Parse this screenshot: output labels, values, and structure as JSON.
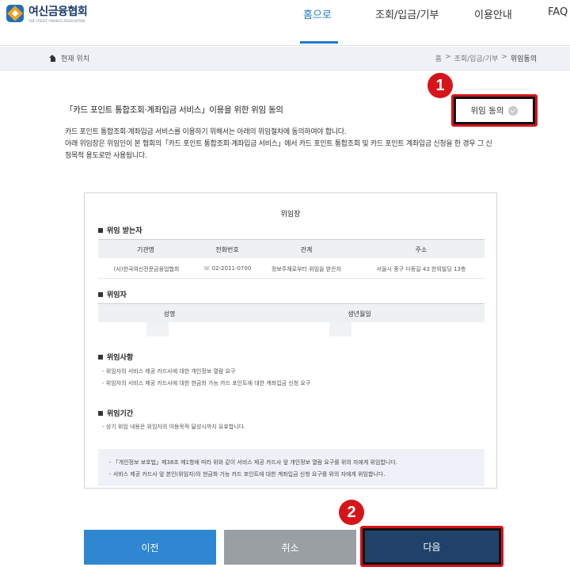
{
  "header": {
    "logo_title": "여신금융협회",
    "logo_sub": "THE CREDIT FINANCE ASSOCIATION",
    "nav": [
      "홈으로",
      "조회/입금/기부",
      "이용안내",
      "FAQ"
    ]
  },
  "breadcrumb": {
    "current_location": "현재 위치",
    "path": [
      "홈",
      ">",
      "조회/입금/기부",
      ">",
      "위임동의"
    ]
  },
  "consent": {
    "title": "「카드 포인트 통합조회·계좌입금 서비스」이용을 위한 위임 동의",
    "agree_label": "위임 동의",
    "desc_line1": "카드 포인트 통합조회·계좌입금 서비스를 이용하기 위해서는 아래의 위임절차에 동의하여야 합니다.",
    "desc_line2": "아래 위임장은 위임인이 본 협회의「카드 포인트 통합조회·계좌입금 서비스」에서 카드 포인트 통합조회 및 카드 포인트 계좌입금 신청을 한 경우 그 신",
    "desc_line3": "청목적 용도로만 사용됩니다."
  },
  "badges": {
    "one": "1",
    "two": "2"
  },
  "document": {
    "title": "위임장",
    "receiver_heading": "위임 받는자",
    "receiver_cols": [
      "기관명",
      "전화번호",
      "관계",
      "주소"
    ],
    "receiver_row": [
      "(사)한국여신전문금융업협회",
      "☏ 02-2011-0700",
      "정보주체로부터 위임을 받은자",
      "서울시 중구 다동길 43 한외빌딩 13층"
    ],
    "delegator_heading": "위임자",
    "delegator_cols": [
      "성명",
      "생년월일"
    ],
    "matters_heading": "위임사항",
    "matters": [
      "- 위임자의 서비스 제공 카드사에 대한 개인정보 열람 요구",
      "- 위임자의 서비스 제공 카드사에 대한 현금화 가능 카드 포인트에 대한 계좌입금 신청 요구"
    ],
    "period_heading": "위임기간",
    "period": [
      "- 상기 위임 내용은 위임자의 이용목적 달성시까지 유효합니다."
    ],
    "notes": [
      "- 「개인정보 보호법」제38조 제1항에 따라 위와 같이 서비스 제공 카드사 앞 개인정보 열람 요구를 위의 자에게 위임합니다.",
      "- 서비스 제공 카드사 앞 본인(위임자)의 현금화 가능 카드 포인트에 대한 계좌입금 신청 요구를 위의 자에게 위임합니다."
    ]
  },
  "buttons": {
    "prev": "이전",
    "cancel": "취소",
    "next": "다음"
  }
}
